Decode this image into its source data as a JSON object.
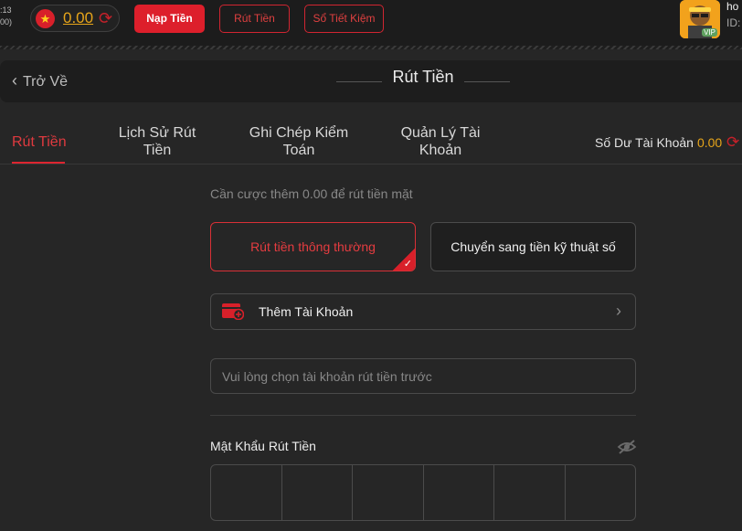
{
  "topbar": {
    "time_line1": ":13",
    "time_line2": "00)",
    "wallet_amount": "0.00",
    "deposit_label": "Nạp Tiền",
    "withdraw_label": "Rút Tiền",
    "savings_label": "Sổ Tiết Kiệm",
    "user_name": "ho",
    "user_id": "ID:",
    "vip_badge": "VIP"
  },
  "header": {
    "back_label": "Trở Về",
    "title": "Rút Tiền"
  },
  "tabs": [
    {
      "label_line1": "Rút Tiền",
      "label_line2": ""
    },
    {
      "label_line1": "Lịch Sử Rút",
      "label_line2": "Tiền"
    },
    {
      "label_line1": "Ghi Chép Kiểm",
      "label_line2": "Toán"
    },
    {
      "label_line1": "Quản Lý Tài",
      "label_line2": "Khoản"
    }
  ],
  "balance": {
    "label": "Số Dư Tài Khoản",
    "value": "0.00"
  },
  "form": {
    "hint": "Cần cược thêm 0.00 để rút tiền mặt",
    "choice_normal": "Rút tiền thông thường",
    "choice_digital": "Chuyển sang tiền kỹ thuật số",
    "add_account": "Thêm Tài Khoản",
    "select_placeholder": "Vui lòng chọn tài khoản rút tiền trước",
    "password_label": "Mật Khẩu Rút Tiền"
  },
  "colors": {
    "accent": "#dd1f2b",
    "gold": "#e7a51a",
    "background": "#262626"
  },
  "icons": [
    "vietnam-flag-icon",
    "refresh-icon",
    "chevron-left-icon",
    "check-icon",
    "wallet-add-icon",
    "chevron-right-icon",
    "eye-off-icon"
  ]
}
